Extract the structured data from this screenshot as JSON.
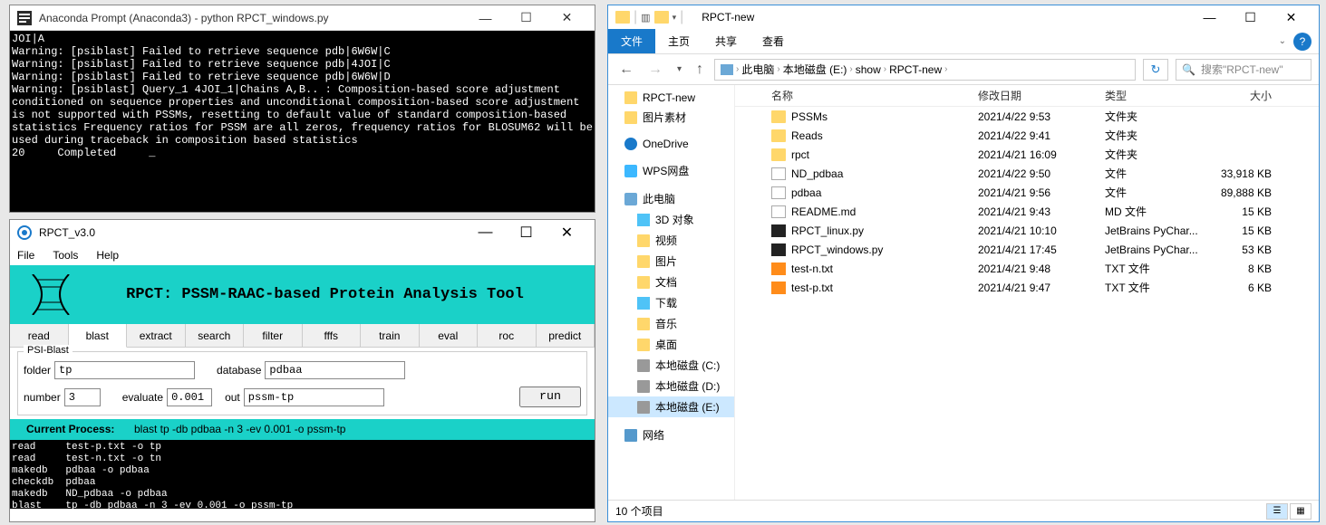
{
  "terminal": {
    "title": "Anaconda Prompt (Anaconda3) - python  RPCT_windows.py",
    "body": "JOI|A\nWarning: [psiblast] Failed to retrieve sequence pdb|6W6W|C\nWarning: [psiblast] Failed to retrieve sequence pdb|4JOI|C\nWarning: [psiblast] Failed to retrieve sequence pdb|6W6W|D\nWarning: [psiblast] Query_1 4JOI_1|Chains A,B.. : Composition-based score adjustment conditioned on sequence properties and unconditional composition-based score adjustment is not supported with PSSMs, resetting to default value of standard composition-based statistics Frequency ratios for PSSM are all zeros, frequency ratios for BLOSUM62 will be used during traceback in composition based statistics\n20     Completed     _"
  },
  "rpct": {
    "title": "RPCT_v3.0",
    "menu": {
      "file": "File",
      "tools": "Tools",
      "help": "Help"
    },
    "banner": "RPCT: PSSM-RAAC-based Protein Analysis Tool",
    "tabs": [
      "read",
      "blast",
      "extract",
      "search",
      "filter",
      "fffs",
      "train",
      "eval",
      "roc",
      "predict"
    ],
    "active_tab": "blast",
    "group_title": "PSI-Blast",
    "fields": {
      "folder_label": "folder",
      "folder_val": "tp",
      "database_label": "database",
      "database_val": "pdbaa",
      "number_label": "number",
      "number_val": "3",
      "evaluate_label": "evaluate",
      "evaluate_val": "0.001",
      "out_label": "out",
      "out_val": "pssm-tp",
      "run": "run"
    },
    "process_label": "Current Process:",
    "process_text": "blast    tp -db pdbaa -n 3 -ev 0.001 -o pssm-tp",
    "log": "read     test-p.txt -o tp\nread     test-n.txt -o tn\nmakedb   pdbaa -o pdbaa\ncheckdb  pdbaa\nmakedb   ND_pdbaa -o pdbaa\nblast    tp -db pdbaa -n 3 -ev 0.001 -o pssm-tp"
  },
  "explorer": {
    "title": "RPCT-new",
    "ribbon": {
      "file": "文件",
      "home": "主页",
      "share": "共享",
      "view": "查看"
    },
    "breadcrumb": [
      "此电脑",
      "本地磁盘 (E:)",
      "show",
      "RPCT-new"
    ],
    "search_placeholder": "搜索\"RPCT-new\"",
    "columns": {
      "name": "名称",
      "date": "修改日期",
      "type": "类型",
      "size": "大小"
    },
    "sidebar": [
      {
        "label": "RPCT-new",
        "icon": "folder"
      },
      {
        "label": "图片素材",
        "icon": "folder"
      },
      {
        "label": "OneDrive",
        "icon": "cloud",
        "top": true
      },
      {
        "label": "WPS网盘",
        "icon": "wps",
        "top": true
      },
      {
        "label": "此电脑",
        "icon": "pc",
        "top": true
      },
      {
        "label": "3D 对象",
        "icon": "cube",
        "indent": 1
      },
      {
        "label": "视频",
        "icon": "folder",
        "indent": 1
      },
      {
        "label": "图片",
        "icon": "folder",
        "indent": 1
      },
      {
        "label": "文档",
        "icon": "folder",
        "indent": 1
      },
      {
        "label": "下载",
        "icon": "down",
        "indent": 1
      },
      {
        "label": "音乐",
        "icon": "folder",
        "indent": 1
      },
      {
        "label": "桌面",
        "icon": "folder",
        "indent": 1
      },
      {
        "label": "本地磁盘 (C:)",
        "icon": "disk",
        "indent": 1
      },
      {
        "label": "本地磁盘 (D:)",
        "icon": "disk",
        "indent": 1
      },
      {
        "label": "本地磁盘 (E:)",
        "icon": "disk",
        "indent": 1,
        "selected": true
      },
      {
        "label": "网络",
        "icon": "net",
        "top": true
      }
    ],
    "files": [
      {
        "name": "PSSMs",
        "date": "2021/4/22 9:53",
        "type": "文件夹",
        "size": "",
        "icon": "folder"
      },
      {
        "name": "Reads",
        "date": "2021/4/22 9:41",
        "type": "文件夹",
        "size": "",
        "icon": "folder"
      },
      {
        "name": "rpct",
        "date": "2021/4/21 16:09",
        "type": "文件夹",
        "size": "",
        "icon": "folder"
      },
      {
        "name": "ND_pdbaa",
        "date": "2021/4/22 9:50",
        "type": "文件",
        "size": "33,918 KB",
        "icon": "file"
      },
      {
        "name": "pdbaa",
        "date": "2021/4/21 9:56",
        "type": "文件",
        "size": "89,888 KB",
        "icon": "file"
      },
      {
        "name": "README.md",
        "date": "2021/4/21 9:43",
        "type": "MD 文件",
        "size": "15 KB",
        "icon": "md"
      },
      {
        "name": "RPCT_linux.py",
        "date": "2021/4/21 10:10",
        "type": "JetBrains PyChar...",
        "size": "15 KB",
        "icon": "py"
      },
      {
        "name": "RPCT_windows.py",
        "date": "2021/4/21 17:45",
        "type": "JetBrains PyChar...",
        "size": "53 KB",
        "icon": "py"
      },
      {
        "name": "test-n.txt",
        "date": "2021/4/21 9:48",
        "type": "TXT 文件",
        "size": "8 KB",
        "icon": "txt"
      },
      {
        "name": "test-p.txt",
        "date": "2021/4/21 9:47",
        "type": "TXT 文件",
        "size": "6 KB",
        "icon": "txt"
      }
    ],
    "status": "10 个项目"
  }
}
